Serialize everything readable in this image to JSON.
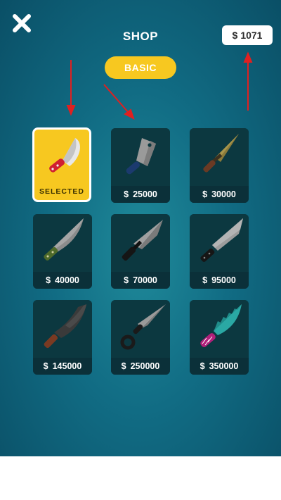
{
  "header": {
    "title": "SHOP",
    "money_currency": "$",
    "money_amount": "1071"
  },
  "tabs": [
    {
      "label": "BASIC",
      "active": true
    }
  ],
  "items": [
    {
      "name": "kitchen-chef-knife",
      "status": "SELECTED"
    },
    {
      "name": "cleaver",
      "currency": "$",
      "price": "25000"
    },
    {
      "name": "bronze-dagger",
      "currency": "$",
      "price": "30000"
    },
    {
      "name": "green-handle-knife",
      "currency": "$",
      "price": "40000"
    },
    {
      "name": "black-combat-knife",
      "currency": "$",
      "price": "70000"
    },
    {
      "name": "tanto-knife",
      "currency": "$",
      "price": "95000"
    },
    {
      "name": "hooked-machete",
      "currency": "$",
      "price": "145000"
    },
    {
      "name": "ring-throwing-knife",
      "currency": "$",
      "price": "250000"
    },
    {
      "name": "teal-serrated-knife",
      "currency": "$",
      "price": "350000"
    }
  ],
  "colors": {
    "background": "#116c84",
    "accent_yellow": "#f7c820",
    "card_bg": "#0f3e48",
    "annotation_red": "#e02020"
  }
}
